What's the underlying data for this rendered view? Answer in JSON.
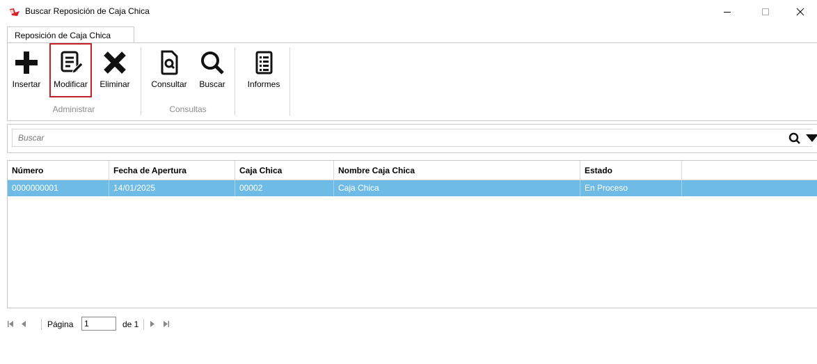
{
  "window": {
    "title": "Buscar Reposición de Caja Chica",
    "controls": {
      "minimize": "—",
      "maximize": "☐",
      "close": "✕"
    }
  },
  "tab": {
    "label": "Reposición de Caja Chica"
  },
  "ribbon": {
    "buttons": [
      {
        "label": "Insertar",
        "icon": "plus-icon"
      },
      {
        "label": "Modificar",
        "icon": "edit-document-icon",
        "selected": true
      },
      {
        "label": "Eliminar",
        "icon": "x-delete-icon"
      },
      {
        "label": "Consultar",
        "icon": "document-search-icon"
      },
      {
        "label": "Buscar",
        "icon": "magnifier-icon"
      },
      {
        "label": "Informes",
        "icon": "report-list-icon"
      }
    ],
    "groups": [
      "Administrar",
      "Consultas"
    ]
  },
  "search": {
    "placeholder": "Buscar"
  },
  "grid": {
    "columns": [
      "Número",
      "Fecha de Apertura",
      "Caja Chica",
      "Nombre Caja Chica",
      "Estado"
    ],
    "rows": [
      [
        "0000000001",
        "14/01/2025",
        "00002",
        "Caja Chica",
        "En Proceso"
      ]
    ],
    "selected_row_color": "#6ebce5"
  },
  "pager": {
    "page_label": "Página",
    "page_value": "1",
    "of_label": "de 1"
  },
  "colors": {
    "selection_border": "#c42027",
    "accent": "#6ebce5"
  }
}
